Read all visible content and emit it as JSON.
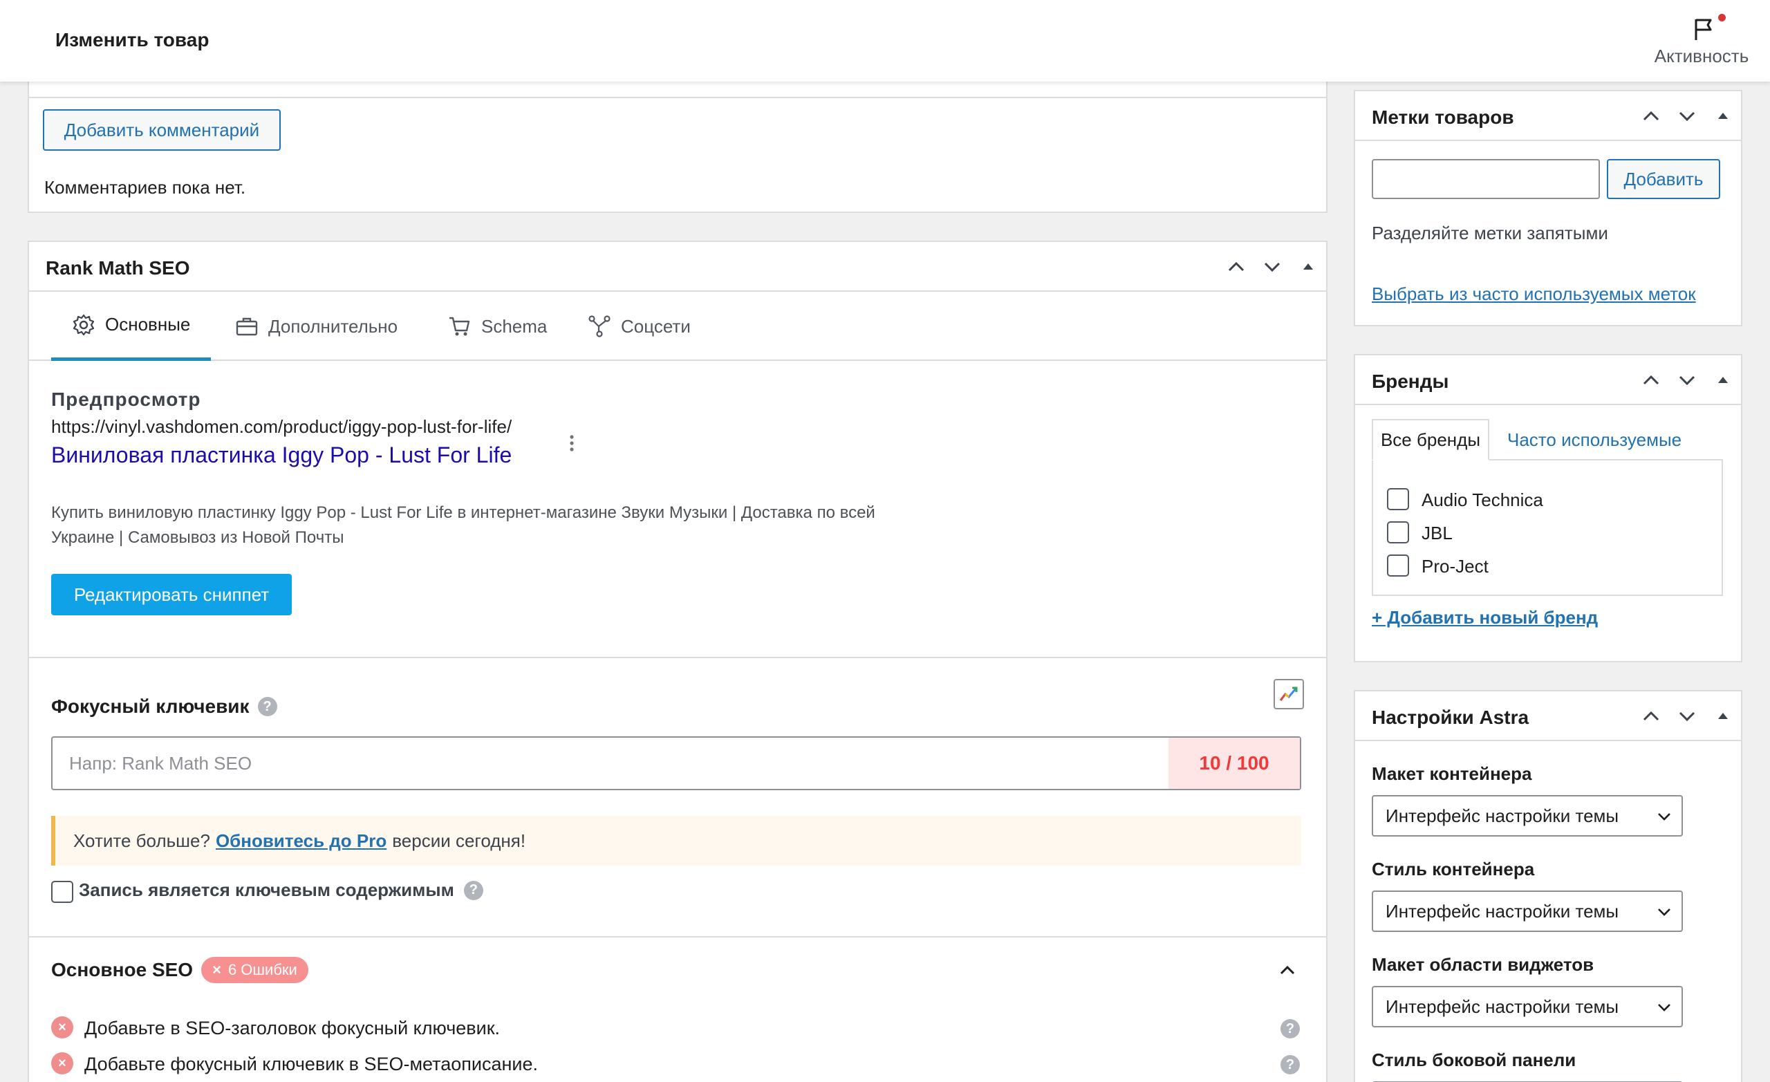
{
  "header": {
    "title": "Изменить товар",
    "activity_label": "Активность"
  },
  "comments": {
    "add_button": "Добавить комментарий",
    "empty_text": "Комментариев пока нет."
  },
  "rankmath": {
    "title": "Rank Math SEO",
    "tabs": [
      {
        "label": "Основные",
        "icon": "gear-icon"
      },
      {
        "label": "Дополнительно",
        "icon": "toolbox-icon"
      },
      {
        "label": "Schema",
        "icon": "cart-icon"
      },
      {
        "label": "Соцсети",
        "icon": "share-icon"
      }
    ],
    "preview_heading": "Предпросмотр",
    "preview_url": "https://vinyl.vashdomen.com/product/iggy-pop-lust-for-life/",
    "preview_title": "Виниловая пластинка Iggy Pop - Lust For Life",
    "preview_description": "Купить виниловую пластинку Iggy Pop - Lust For Life в интернет-магазине Звуки Музыки | Доставка по всей Украине | Самовывоз из Новой Почты",
    "edit_snippet_button": "Редактировать сниппет",
    "focus_keyword_label": "Фокусный ключевик",
    "focus_keyword_placeholder": "Напр: Rank Math SEO",
    "score": "10 / 100",
    "notice_before": "Хотите больше?",
    "notice_link": "Обновитесь до Pro",
    "notice_after": "версии сегодня!",
    "pillar_label": "Запись является ключевым содержимым",
    "basic_seo_title": "Основное SEO",
    "errors_badge": "6 Ошибки",
    "errors": [
      "Добавьте в SEO-заголовок фокусный ключевик.",
      "Добавьте фокусный ключевик в SEO-метаописание."
    ],
    "help_glyph": "?",
    "close_glyph": "×"
  },
  "tags": {
    "title": "Метки товаров",
    "add_button": "Добавить",
    "hint": "Разделяйте метки запятыми",
    "choose_link": "Выбрать из часто используемых меток"
  },
  "brands": {
    "title": "Бренды",
    "tab_all": "Все бренды",
    "tab_popular": "Часто используемые",
    "items": [
      "Audio Technica",
      "JBL",
      "Pro-Ject"
    ],
    "add_link": "+ Добавить новый бренд"
  },
  "astra": {
    "title": "Настройки Astra",
    "fields": [
      {
        "label": "Макет контейнера",
        "value": "Интерфейс настройки темы"
      },
      {
        "label": "Стиль контейнера",
        "value": "Интерфейс настройки темы"
      },
      {
        "label": "Макет области виджетов",
        "value": "Интерфейс настройки темы"
      },
      {
        "label": "Стиль боковой панели",
        "value": ""
      }
    ]
  },
  "colors": {
    "accent": "#2271b1",
    "rankmath_blue": "#10a2e6",
    "error": "#ee3a3a",
    "serp_title": "#1a0dab"
  }
}
